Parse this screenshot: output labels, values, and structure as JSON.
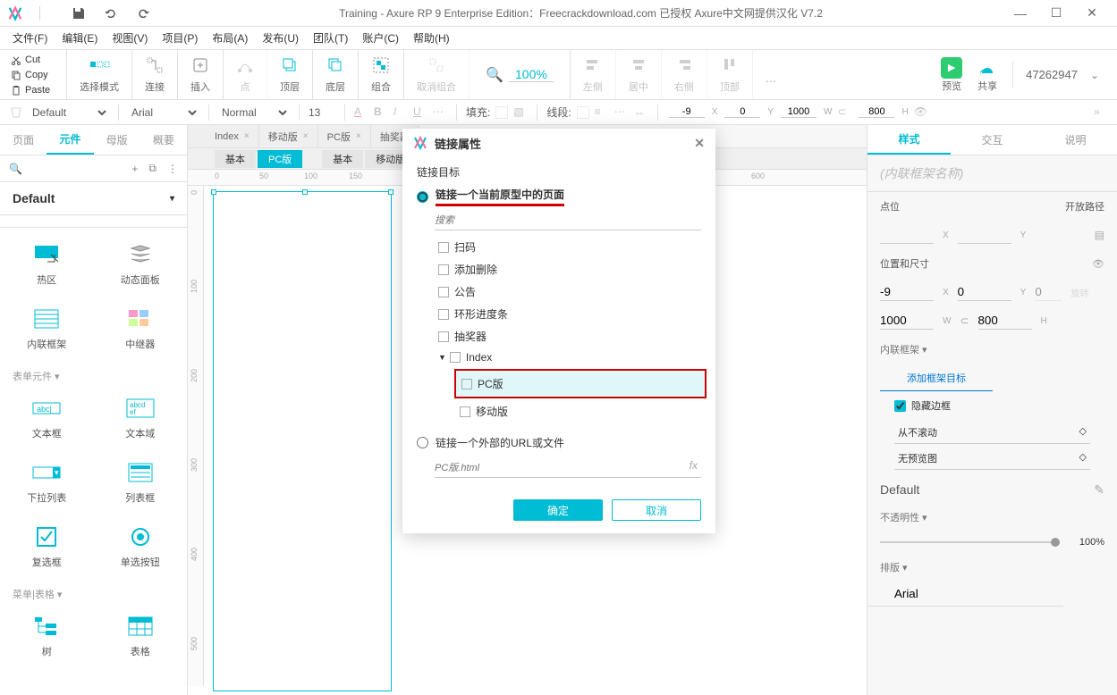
{
  "titlebar": {
    "title": "Training - Axure RP 9 Enterprise Edition：Freecrackdownload.com 已授权    Axure中文网提供汉化 V7.2"
  },
  "menubar": [
    "文件(F)",
    "编辑(E)",
    "视图(V)",
    "项目(P)",
    "布局(A)",
    "发布(U)",
    "团队(T)",
    "账户(C)",
    "帮助(H)"
  ],
  "clip": {
    "cut": "Cut",
    "copy": "Copy",
    "paste": "Paste"
  },
  "ribbon": {
    "select": "选择模式",
    "connect": "连接",
    "insert": "插入",
    "point": "点",
    "top": "顶层",
    "bottom": "底层",
    "group": "组合",
    "ungroup": "取消组合",
    "zoom": "100%",
    "left": "左侧",
    "center": "居中",
    "right": "右侧",
    "top2": "顶部",
    "preview": "预览",
    "share": "共享",
    "user": "47262947"
  },
  "styletb": {
    "style": "Default",
    "font": "Arial",
    "weight": "Normal",
    "size": "13",
    "fill": "填充:",
    "line": "线段:",
    "x": "-9",
    "y": "0",
    "w": "1000",
    "h": "800"
  },
  "leftpanel": {
    "tabs": [
      "页面",
      "元件",
      "母版",
      "概要"
    ],
    "activeTab": 1,
    "library": "Default",
    "widgets": [
      {
        "name": "热区"
      },
      {
        "name": "动态面板"
      },
      {
        "name": "内联框架"
      },
      {
        "name": "中继器"
      },
      {
        "name": "文本框"
      },
      {
        "name": "文本域"
      },
      {
        "name": "下拉列表"
      },
      {
        "name": "列表框"
      },
      {
        "name": "复选框"
      },
      {
        "name": "单选按钮"
      },
      {
        "name": "树"
      },
      {
        "name": "表格"
      }
    ],
    "groups": [
      "表单元件 ▾",
      "菜单|表格 ▾"
    ]
  },
  "doctabs": [
    "Index",
    "移动版",
    "PC版",
    "抽奖器"
  ],
  "viewtabs": [
    "基本",
    "PC版",
    "基本",
    "移动版"
  ],
  "rulerH": [
    0,
    50,
    100,
    150,
    600
  ],
  "rulerV": [
    0,
    100,
    200,
    300,
    400,
    500
  ],
  "rightpanel": {
    "tabs": [
      "样式",
      "交互",
      "说明"
    ],
    "activeTab": 0,
    "namePlaceholder": "(内联框架名称)",
    "poslabel": "点位",
    "openlabel": "开放路径",
    "xlabel": "X",
    "ylabel": "Y",
    "sizelabel": "位置和尺寸",
    "x": "-9",
    "y": "0",
    "w": "1000",
    "h": "800",
    "wlabel": "W",
    "hlabel": "H",
    "rot": "0",
    "rotlabel": "旋转",
    "frameSection": "内联框架 ▾",
    "addTarget": "添加框架目标",
    "hideBorder": "隐藏边框",
    "scroll": "从不滚动",
    "preview": "无预览图",
    "styleName": "Default",
    "opacity": "不透明性 ▾",
    "opacityVal": "100%",
    "layout": "排版 ▾",
    "font": "Arial"
  },
  "modal": {
    "title": "链接属性",
    "section": "链接目标",
    "radio1": "链接一个当前原型中的页面",
    "searchPlaceholder": "搜索",
    "tree": [
      "扫码",
      "添加删除",
      "公告",
      "环形进度条",
      "抽奖器"
    ],
    "indexNode": "Index",
    "pcNode": "PC版",
    "mobileNode": "移动版",
    "radio2": "链接一个外部的URL或文件",
    "urlPlaceholder": "PC版.html",
    "ok": "确定",
    "cancel": "取消"
  }
}
